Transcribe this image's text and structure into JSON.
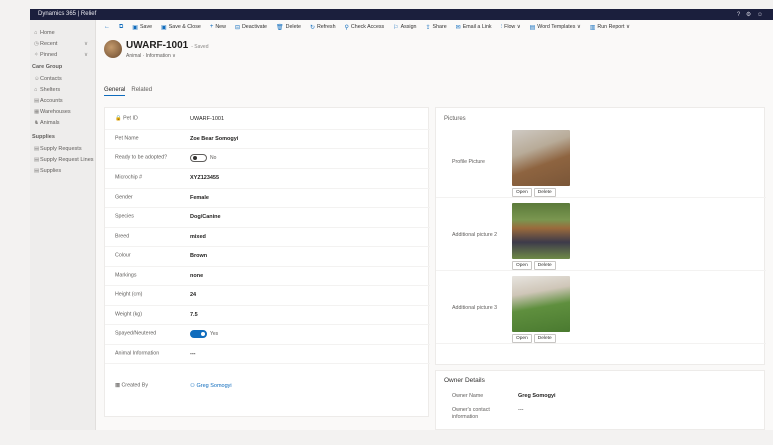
{
  "app": {
    "title": "Dynamics 365 | Relief",
    "topbar_right": "? ⚙ ☺"
  },
  "sidebar": {
    "items_top": [
      {
        "icon": "home-icon",
        "glyph": "⌂",
        "label": "Home"
      },
      {
        "icon": "recent-icon",
        "glyph": "◷",
        "label": "Recent",
        "chevron": true
      },
      {
        "icon": "pinned-icon",
        "glyph": "✧",
        "label": "Pinned",
        "chevron": true
      }
    ],
    "section1": "Care Group",
    "items_care": [
      {
        "icon": "contacts-icon",
        "glyph": "☺",
        "label": "Contacts"
      },
      {
        "icon": "shelters-icon",
        "glyph": "⌂",
        "label": "Shelters"
      },
      {
        "icon": "accounts-icon",
        "glyph": "▤",
        "label": "Accounts"
      },
      {
        "icon": "warehouses-icon",
        "glyph": "▦",
        "label": "Warehouses"
      },
      {
        "icon": "animals-icon",
        "glyph": "♞",
        "label": "Animals"
      }
    ],
    "section2": "Supplies",
    "items_supplies": [
      {
        "icon": "supply-requests-icon",
        "glyph": "▤",
        "label": "Supply Requests"
      },
      {
        "icon": "supply-request-lines-icon",
        "glyph": "▤",
        "label": "Supply Request Lines"
      },
      {
        "icon": "supplies-icon",
        "glyph": "▤",
        "label": "Supplies"
      }
    ]
  },
  "commandbar": [
    {
      "icon": "back-icon",
      "glyph": "←",
      "label": ""
    },
    {
      "icon": "popout-icon",
      "glyph": "⧉",
      "label": ""
    },
    {
      "icon": "save-icon",
      "glyph": "▣",
      "label": "Save"
    },
    {
      "icon": "save-close-icon",
      "glyph": "▣",
      "label": "Save & Close"
    },
    {
      "icon": "new-icon",
      "glyph": "+",
      "label": "New"
    },
    {
      "icon": "deactivate-icon",
      "glyph": "⊟",
      "label": "Deactivate"
    },
    {
      "icon": "delete-icon",
      "glyph": "🗑",
      "label": "Delete"
    },
    {
      "icon": "refresh-icon",
      "glyph": "↻",
      "label": "Refresh"
    },
    {
      "icon": "check-access-icon",
      "glyph": "⚲",
      "label": "Check Access"
    },
    {
      "icon": "assign-icon",
      "glyph": "⚐",
      "label": "Assign"
    },
    {
      "icon": "share-icon",
      "glyph": "⇪",
      "label": "Share"
    },
    {
      "icon": "email-link-icon",
      "glyph": "✉",
      "label": "Email a Link"
    },
    {
      "icon": "flow-icon",
      "glyph": "⫶",
      "label": "Flow ∨"
    },
    {
      "icon": "word-templates-icon",
      "glyph": "▤",
      "label": "Word Templates ∨"
    },
    {
      "icon": "run-report-icon",
      "glyph": "▥",
      "label": "Run Report ∨"
    }
  ],
  "record": {
    "title": "UWARF-1001",
    "saved": "- Saved",
    "subtitle": "Animal · Information ∨"
  },
  "tabs": [
    {
      "label": "General",
      "active": true
    },
    {
      "label": "Related",
      "active": false
    }
  ],
  "fields": [
    {
      "label": "Pet ID",
      "value": "UWARF-1001",
      "style": "plain"
    },
    {
      "label": "Pet Name",
      "value": "Zoe Bear Somogyi",
      "style": "bold"
    },
    {
      "label": "Ready to be adopted?",
      "value": "No",
      "style": "toggle-off"
    },
    {
      "label": "Microchip #",
      "value": "XYZ123455",
      "style": "bold"
    },
    {
      "label": "Gender",
      "value": "Female",
      "style": "bold"
    },
    {
      "label": "Species",
      "value": "Dog/Canine",
      "style": "bold"
    },
    {
      "label": "Breed",
      "value": "mixed",
      "style": "bold"
    },
    {
      "label": "Colour",
      "value": "Brown",
      "style": "bold"
    },
    {
      "label": "Markings",
      "value": "none",
      "style": "bold"
    },
    {
      "label": "Height (cm)",
      "value": "24",
      "style": "bold"
    },
    {
      "label": "Weight (kg)",
      "value": "7.5",
      "style": "bold"
    },
    {
      "label": "Spayed/Neutered",
      "value": "Yes",
      "style": "toggle-on"
    },
    {
      "label": "Animal Information",
      "value": "---",
      "style": "bold"
    },
    {
      "label": "Created By",
      "value": "Greg Somogyi",
      "style": "link"
    }
  ],
  "pictures": {
    "title": "Pictures",
    "rows": [
      {
        "label": "Profile Picture"
      },
      {
        "label": "Additional picture 2"
      },
      {
        "label": "Additional picture 3"
      }
    ],
    "open_label": "Open",
    "delete_label": "Delete"
  },
  "owner": {
    "title": "Owner Details",
    "name_label": "Owner Name",
    "name_value": "Greg Somogyi",
    "contact_label": "Owner's contact information",
    "contact_value": "---"
  }
}
